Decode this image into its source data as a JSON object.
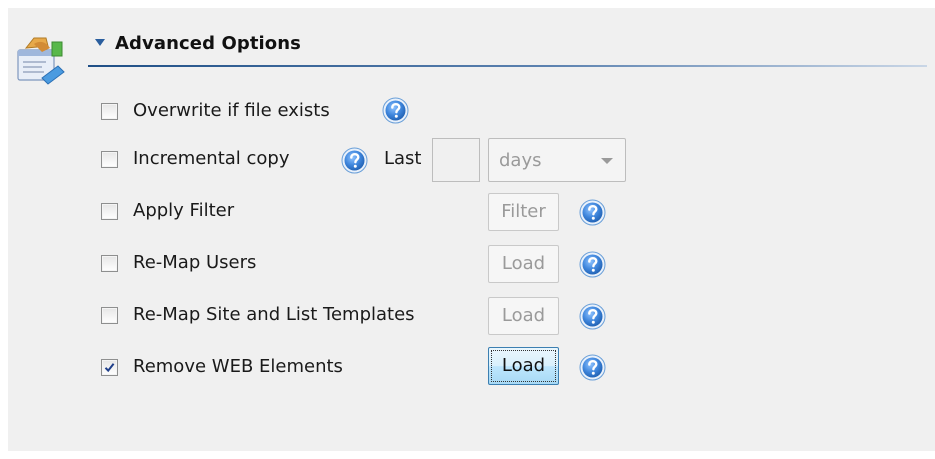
{
  "section": {
    "title": "Advanced Options",
    "icon": "settings-pencil-icon"
  },
  "options": [
    {
      "label": "Overwrite if file exists",
      "checked": false,
      "help_icon": "help-icon"
    },
    {
      "label": "Incremental copy",
      "checked": false,
      "help_icon": "help-icon",
      "last_label": "Last",
      "last_value": "",
      "unit_selected": "days"
    },
    {
      "label": "Apply Filter",
      "checked": false,
      "button_label": "Filter",
      "help_icon": "help-icon"
    },
    {
      "label": "Re-Map Users",
      "checked": false,
      "button_label": "Load",
      "help_icon": "help-icon"
    },
    {
      "label": "Re-Map Site and List Templates",
      "checked": false,
      "button_label": "Load",
      "help_icon": "help-icon"
    },
    {
      "label": "Remove WEB Elements",
      "checked": true,
      "button_label": "Load",
      "help_icon": "help-icon"
    }
  ],
  "colors": {
    "accent": "#2a5e9e",
    "help_blue": "#2b6fc4",
    "panel_bg": "#f0f0f0"
  }
}
